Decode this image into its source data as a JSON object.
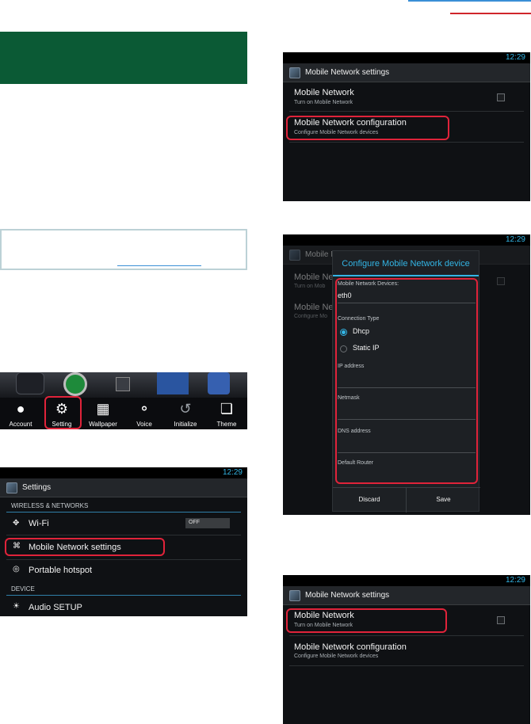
{
  "status_time": "12:29",
  "launcher": {
    "items": [
      {
        "label": "Account",
        "icon": "person-icon"
      },
      {
        "label": "Setting",
        "icon": "gear-icon"
      },
      {
        "label": "Wallpaper",
        "icon": "wallpaper-icon"
      },
      {
        "label": "Voice",
        "icon": "microphone-icon"
      },
      {
        "label": "Initialize",
        "icon": "reset-icon"
      },
      {
        "label": "Theme",
        "icon": "theme-icon"
      }
    ]
  },
  "settings": {
    "title": "Settings",
    "cat_wireless": "WIRELESS & NETWORKS",
    "wifi": "Wi-Fi",
    "wifi_toggle": "OFF",
    "mobile_net": "Mobile Network settings",
    "hotspot": "Portable hotspot",
    "cat_device": "DEVICE",
    "audio": "Audio SETUP"
  },
  "mns": {
    "title": "Mobile Network settings",
    "item1_title": "Mobile Network",
    "item1_sub": "Turn on Mobile Network",
    "item2_title": "Mobile Network configuration",
    "item2_sub": "Configure Mobile Network devices"
  },
  "config_dialog": {
    "bg_title_trunc": "Mobile Ne",
    "bg_item1_trunc": "Mobile Netw",
    "bg_item1_sub_trunc": "Turn on Mob",
    "bg_item2_trunc": "Mobile Ne",
    "bg_item2_sub_trunc": "Configure Mo",
    "title": "Configure Mobile Network device",
    "devices_label": "Mobile Network Devices:",
    "device_value": "eth0",
    "conn_type_label": "Connection Type",
    "opt_dhcp": "Dhcp",
    "opt_static": "Static IP",
    "ip_label": "IP address",
    "netmask_label": "Netmask",
    "dns_label": "DNS address",
    "router_label": "Default Router",
    "discard": "Discard",
    "save": "Save"
  },
  "colors": {
    "highlight": "#e0233a",
    "accent": "#33b5e5",
    "band": "#0b5a35"
  }
}
